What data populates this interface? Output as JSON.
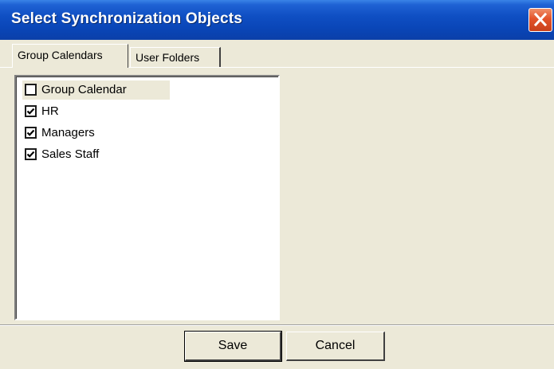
{
  "window": {
    "title": "Select Synchronization Objects"
  },
  "tabs": [
    {
      "label": "Group Calendars",
      "active": true
    },
    {
      "label": "User Folders",
      "active": false
    }
  ],
  "list": {
    "items": [
      {
        "label": "Group Calendar",
        "checked": false,
        "highlighted": true
      },
      {
        "label": "HR",
        "checked": true,
        "highlighted": false
      },
      {
        "label": "Managers",
        "checked": true,
        "highlighted": false
      },
      {
        "label": "Sales Staff",
        "checked": true,
        "highlighted": false
      }
    ]
  },
  "buttons": {
    "save_label": "Save",
    "cancel_label": "Cancel"
  },
  "icons": {
    "close": "close-icon",
    "check": "check-icon"
  },
  "colors": {
    "titlebar": "#0a46b8",
    "close_button": "#e3532a",
    "dialog_background": "#ece9d8"
  }
}
